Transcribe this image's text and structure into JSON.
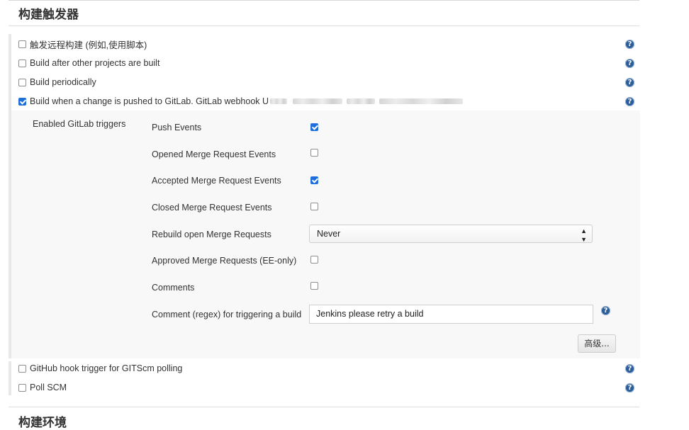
{
  "sections": {
    "build_triggers_title": "构建触发器",
    "build_env_title": "构建环境"
  },
  "triggers": [
    {
      "label": "触发远程构建 (例如,使用脚本)",
      "checked": false
    },
    {
      "label": "Build after other projects are built",
      "checked": false
    },
    {
      "label": "Build periodically",
      "checked": false
    },
    {
      "label": "Build when a change is pushed to GitLab. GitLab webhook U",
      "checked": true
    },
    {
      "label": "GitHub hook trigger for GITScm polling",
      "checked": false
    },
    {
      "label": "Poll SCM",
      "checked": false
    }
  ],
  "gitlab": {
    "enabled_triggers_label": "Enabled GitLab triggers",
    "options": [
      {
        "label": "Push Events",
        "checked": true
      },
      {
        "label": "Opened Merge Request Events",
        "checked": false
      },
      {
        "label": "Accepted Merge Request Events",
        "checked": true
      },
      {
        "label": "Closed Merge Request Events",
        "checked": false
      }
    ],
    "rebuild_label": "Rebuild open Merge Requests",
    "rebuild_value": "Never",
    "approved_label": "Approved Merge Requests (EE-only)",
    "approved_checked": false,
    "comments_label": "Comments",
    "comments_checked": false,
    "comment_regex_label": "Comment (regex) for triggering a build",
    "comment_regex_value": "Jenkins please retry a build",
    "advanced_button": "高级..."
  },
  "icons": {
    "help": "help-icon",
    "help_glyph": "?"
  },
  "colors": {
    "checkbox_checked": "#1e6fd9",
    "help_icon": "#2b5d9a",
    "panel_bg": "#f8f8f8"
  }
}
